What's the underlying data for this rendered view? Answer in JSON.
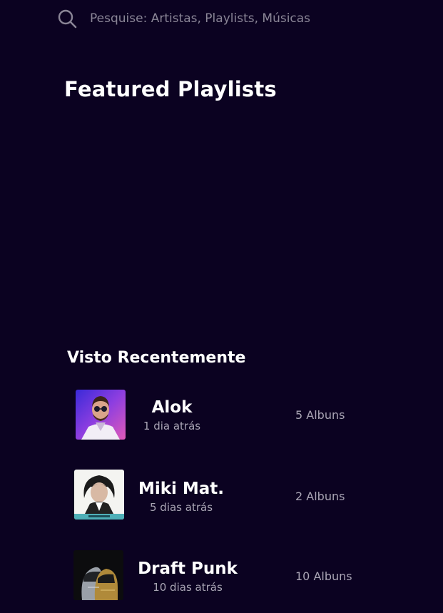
{
  "search": {
    "placeholder": "Pesquise: Artistas, Playlists, Músicas",
    "icon": "search-icon"
  },
  "featured": {
    "title": "Featured Playlists"
  },
  "recent": {
    "title": "Visto Recentemente",
    "items": [
      {
        "name": "Alok",
        "time": "1 dia atrás",
        "albums": "5 Albuns"
      },
      {
        "name": "Miki Mat.",
        "time": "5 dias atrás",
        "albums": "2 Albuns"
      },
      {
        "name": "Draft Punk",
        "time": "10 dias atrás",
        "albums": "10 Albuns"
      }
    ]
  },
  "colors": {
    "background": "#0b0221",
    "text": "#ffffff",
    "muted": "#a9a4b4"
  }
}
